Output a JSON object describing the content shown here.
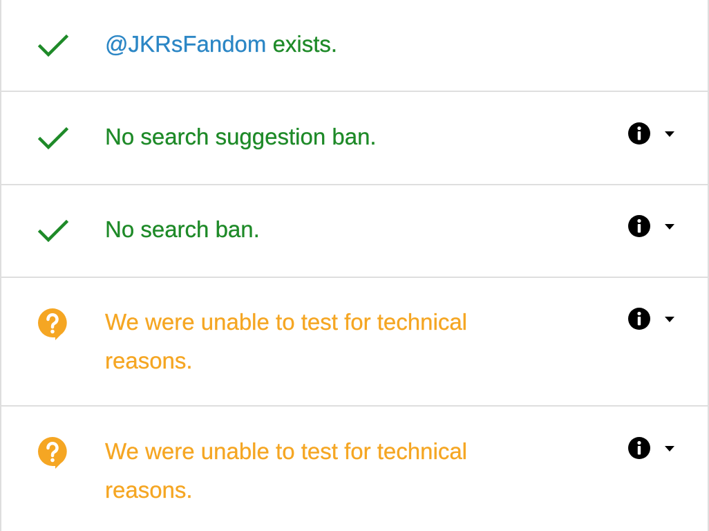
{
  "colors": {
    "ok": "#1e8a28",
    "warn": "#f5a623",
    "handle": "#2b86c5",
    "divider": "#dedede",
    "info": "#000000"
  },
  "results": [
    {
      "status": "ok",
      "icon": "checkmark-icon",
      "handle": "@JKRsFandom",
      "text": " exists."
    },
    {
      "status": "ok",
      "icon": "checkmark-icon",
      "text": "No search suggestion ban.",
      "has_details": true
    },
    {
      "status": "ok",
      "icon": "checkmark-icon",
      "text": "No search ban.",
      "has_details": true
    },
    {
      "status": "unknown",
      "icon": "question-bubble-icon",
      "text": "We were unable to test for technical reasons.",
      "has_details": true
    },
    {
      "status": "unknown",
      "icon": "question-bubble-icon",
      "text": "We were unable to test for technical reasons.",
      "has_details": true
    }
  ]
}
